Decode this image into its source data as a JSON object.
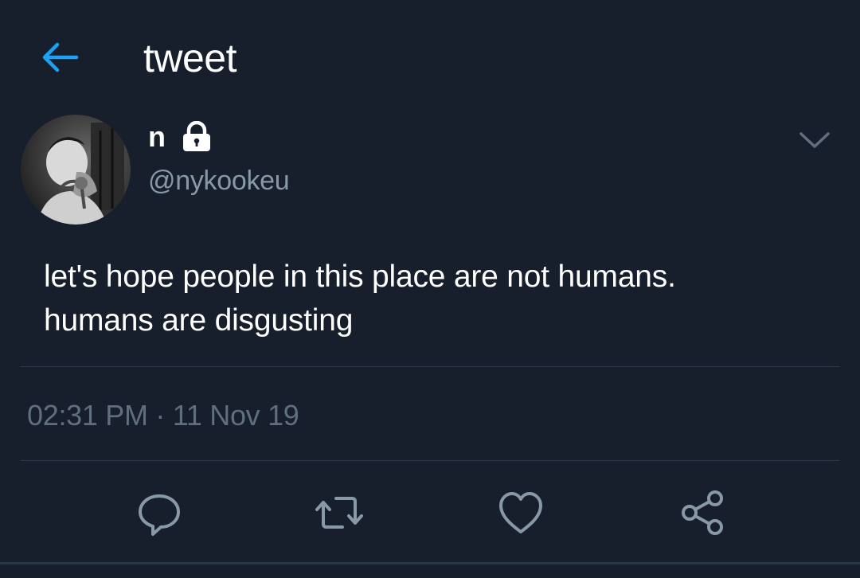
{
  "header": {
    "title": "tweet",
    "back_icon": "arrow-left-icon",
    "accent_color": "#1da1f2"
  },
  "tweet": {
    "author": {
      "display_name": "n",
      "handle": "@nykookeu",
      "protected_icon": "lock-icon"
    },
    "text_lines": [
      "let's hope people in this place are not humans.",
      "humans are disgusting"
    ],
    "timestamp": "02:31 PM · 11 Nov 19"
  },
  "actions": [
    {
      "name": "reply",
      "icon": "reply-icon"
    },
    {
      "name": "retweet",
      "icon": "retweet-icon"
    },
    {
      "name": "like",
      "icon": "heart-icon"
    },
    {
      "name": "share",
      "icon": "share-icon"
    }
  ],
  "colors": {
    "background": "#161f2b",
    "secondary_text": "#8899a6",
    "divider": "#2b3845"
  }
}
